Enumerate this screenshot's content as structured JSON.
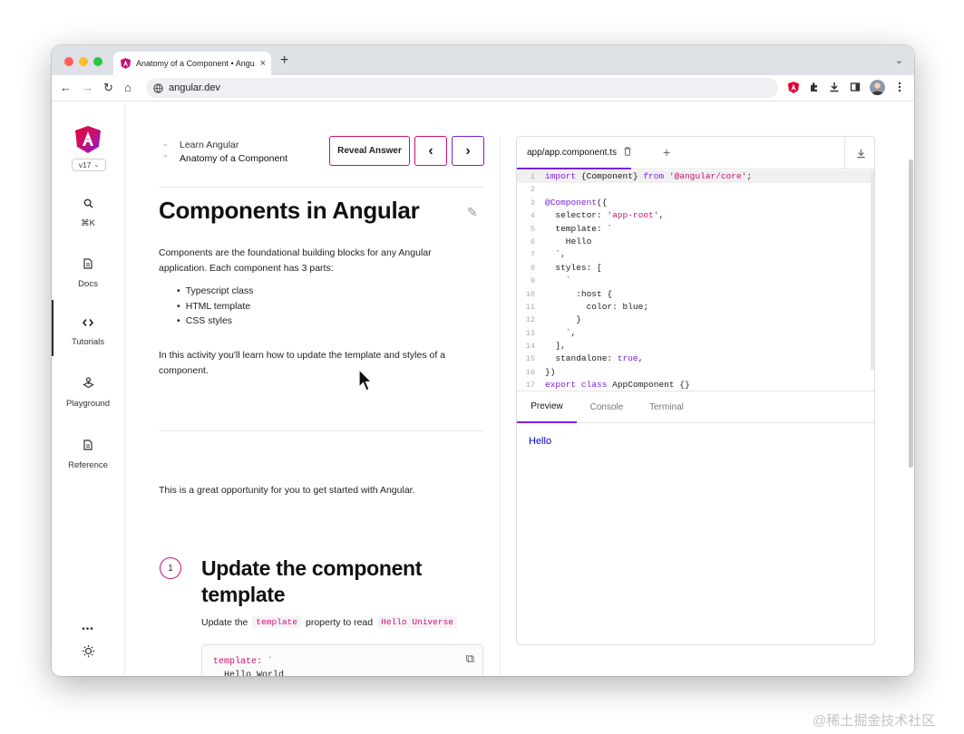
{
  "browser": {
    "tab_title": "Anatomy of a Component • Angular",
    "new_tab": "+",
    "tab_close": "×",
    "tab_menu": "⌄",
    "url": "angular.dev",
    "nav": {
      "back": "←",
      "forward": "→",
      "reload": "↻",
      "home": "⌂"
    },
    "traffic_colors": [
      "#ff5f57",
      "#febc2e",
      "#28c840"
    ]
  },
  "sidebar": {
    "version": "v17",
    "items": [
      {
        "label": "⌘K",
        "icon": "search-icon"
      },
      {
        "label": "Docs",
        "icon": "doc-icon"
      },
      {
        "label": "Tutorials",
        "icon": "code-icon"
      },
      {
        "label": "Playground",
        "icon": "playground-icon"
      },
      {
        "label": "Reference",
        "icon": "doc-icon"
      }
    ],
    "more": "•••"
  },
  "content": {
    "breadcrumb_parent": "Learn Angular",
    "breadcrumb_current": "Anatomy of a Component",
    "reveal_button": "Reveal Answer",
    "prev_button": "‹",
    "next_button": "›",
    "title": "Components in Angular",
    "intro": "Components are the foundational building blocks for any Angular application. Each component has 3 parts:",
    "parts": [
      "Typescript class",
      "HTML template",
      "CSS styles"
    ],
    "activity": "In this activity you'll learn how to update the template and styles of a component.",
    "opportunity": "This is a great opportunity for you to get started with Angular.",
    "step_number": "1",
    "step_title": "Update the component template",
    "instruction": {
      "pre": "Update the",
      "code1": "template",
      "mid": "property to read",
      "code2": "Hello Universe"
    },
    "snippet": {
      "line1": "template: `",
      "line2": "  Hello World"
    }
  },
  "editor": {
    "file_tab": "app/app.component.ts",
    "add_tab": "+",
    "code_lines": [
      "import {Component} from '@angular/core';",
      "",
      "@Component({",
      "  selector: 'app-root',",
      "  template: `",
      "    Hello",
      "  `,",
      "  styles: [",
      "    `",
      "      :host {",
      "        color: blue;",
      "      }",
      "    `,",
      "  ],",
      "  standalone: true,",
      "})",
      "export class AppComponent {}"
    ],
    "line_numbers": [
      "1",
      "2",
      "3",
      "4",
      "5",
      "6",
      "7",
      "8",
      "9",
      "10",
      "11",
      "12",
      "13",
      "14",
      "15",
      "16",
      "17"
    ],
    "preview_tabs": [
      "Preview",
      "Console",
      "Terminal"
    ],
    "preview_output": "Hello",
    "preview_color": "#0000cd"
  },
  "accent": "#c5126f",
  "tab_accent": "#7b1fe0",
  "watermark": "@稀土掘金技术社区"
}
